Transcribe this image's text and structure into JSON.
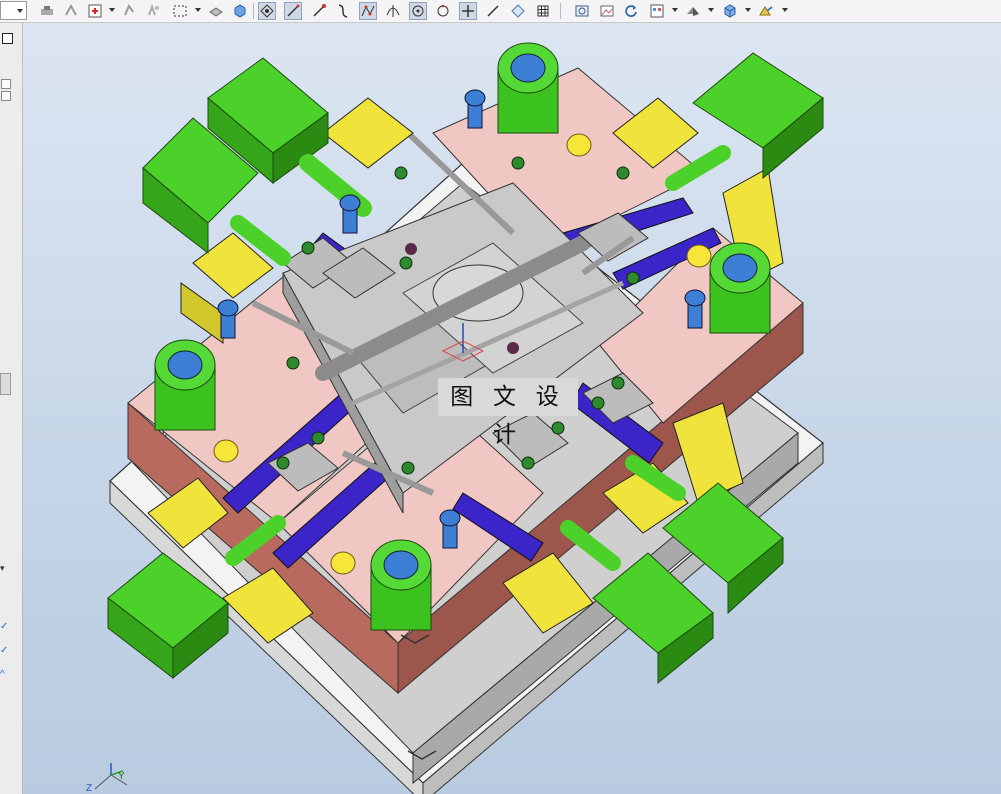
{
  "viewport": {
    "watermark_text": "图 文 设 计",
    "triad": {
      "x_label": "Y",
      "y_label": "Z"
    }
  },
  "colors": {
    "plate_pink": "#f1c7c4",
    "plate_side": "#b86a5f",
    "steel_grey": "#c9c9c9",
    "cylinder_green": "#4cd12a",
    "bracket_yellow": "#f0e33c",
    "rail_blue": "#3b24c8",
    "bolt_blue": "#3e7fd6",
    "pin_yellow": "#f7e53a"
  },
  "toolbar": {
    "icons": [
      "show-hide-icon",
      "snap-point-icon",
      "select-filter-icon",
      "rotate-icon",
      "box-select-icon",
      "view-shaded-icon",
      "view-solid-icon",
      "vertex-snap-icon",
      "line-icon",
      "edge-icon",
      "curve-icon",
      "spline-icon",
      "arc-icon",
      "circle-center-icon",
      "circle-icon",
      "plus-icon",
      "slash-icon",
      "measure-icon",
      "grid-icon",
      "camera-icon",
      "image-icon",
      "refresh-icon",
      "layout-icon",
      "shade-icon",
      "cube-icon",
      "analysis-icon"
    ]
  }
}
